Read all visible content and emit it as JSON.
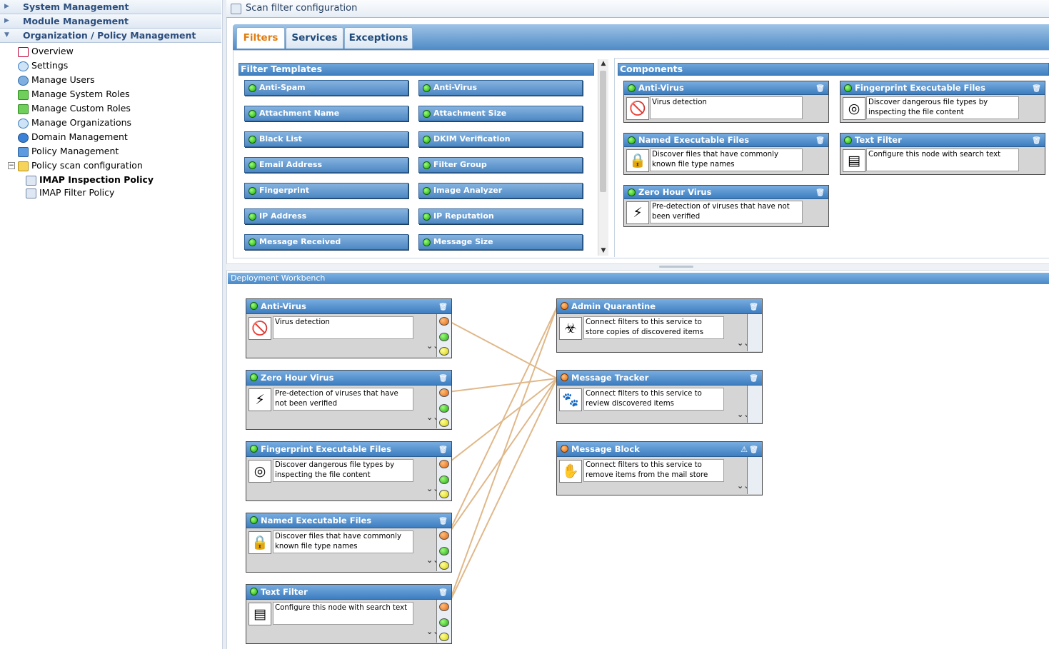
{
  "nav": {
    "sections": [
      {
        "label": "System Management"
      },
      {
        "label": "Module Management"
      },
      {
        "label": "Organization / Policy Management"
      }
    ],
    "items": [
      {
        "label": "Overview"
      },
      {
        "label": "Settings"
      },
      {
        "label": "Manage Users"
      },
      {
        "label": "Manage System Roles"
      },
      {
        "label": "Manage Custom Roles"
      },
      {
        "label": "Manage Organizations"
      },
      {
        "label": "Domain Management"
      },
      {
        "label": "Policy Management"
      },
      {
        "label": "Policy scan configuration"
      },
      {
        "label": "IMAP Inspection Policy"
      },
      {
        "label": "IMAP Filter Policy"
      }
    ]
  },
  "header": {
    "title": "Scan filter configuration"
  },
  "tabs": [
    {
      "label": "Filters",
      "active": true
    },
    {
      "label": "Services",
      "active": false
    },
    {
      "label": "Exceptions",
      "active": false
    }
  ],
  "filter_templates": {
    "title": "Filter  Templates",
    "items": [
      "Anti-Spam",
      "Anti-Virus",
      "Attachment Name",
      "Attachment Size",
      "Black List",
      "DKIM Verification",
      "Email Address",
      "Filter Group",
      "Fingerprint",
      "Image Analyzer",
      "IP Address",
      "IP Reputation",
      "Message Received",
      "Message Size"
    ]
  },
  "components": {
    "title": "Components",
    "items": [
      {
        "title": "Anti-Virus",
        "desc": "Virus detection",
        "icon": "virus-icon"
      },
      {
        "title": "Fingerprint Executable Files",
        "desc": "Discover dangerous file types by inspecting the file content",
        "icon": "fingerprint-icon"
      },
      {
        "title": "Named Executable Files",
        "desc": "Discover files that have commonly known file type names",
        "icon": "lock-icon"
      },
      {
        "title": "Text Filter",
        "desc": "Configure this node with search text",
        "icon": "document-icon"
      },
      {
        "title": "Zero Hour Virus",
        "desc": "Pre-detection of viruses that have not been verified",
        "icon": "zero-hour-virus-icon"
      }
    ]
  },
  "workbench": {
    "title": "Deployment Workbench",
    "filters": [
      {
        "title": "Anti-Virus",
        "desc": "Virus detection",
        "icon": "virus-icon"
      },
      {
        "title": "Zero Hour Virus",
        "desc": "Pre-detection of viruses that have not been verified",
        "icon": "zero-hour-virus-icon"
      },
      {
        "title": "Fingerprint Executable Files",
        "desc": "Discover dangerous file types by inspecting the file content",
        "icon": "fingerprint-icon"
      },
      {
        "title": "Named Executable Files",
        "desc": "Discover files that have commonly known file type names",
        "icon": "lock-icon"
      },
      {
        "title": "Text Filter",
        "desc": "Configure this node with search text",
        "icon": "document-icon"
      }
    ],
    "services": [
      {
        "title": "Admin Quarantine",
        "desc": "Connect filters to this service to store copies of discovered items",
        "icon": "biohazard-icon"
      },
      {
        "title": "Message Tracker",
        "desc": "Connect filters to this service to review discovered items",
        "icon": "paw-prints-icon"
      },
      {
        "title": "Message Block",
        "desc": "Connect filters to this service to remove items from the mail store",
        "icon": "stop-hand-icon",
        "warning": true
      }
    ],
    "connection_color": "#e0b88a"
  }
}
